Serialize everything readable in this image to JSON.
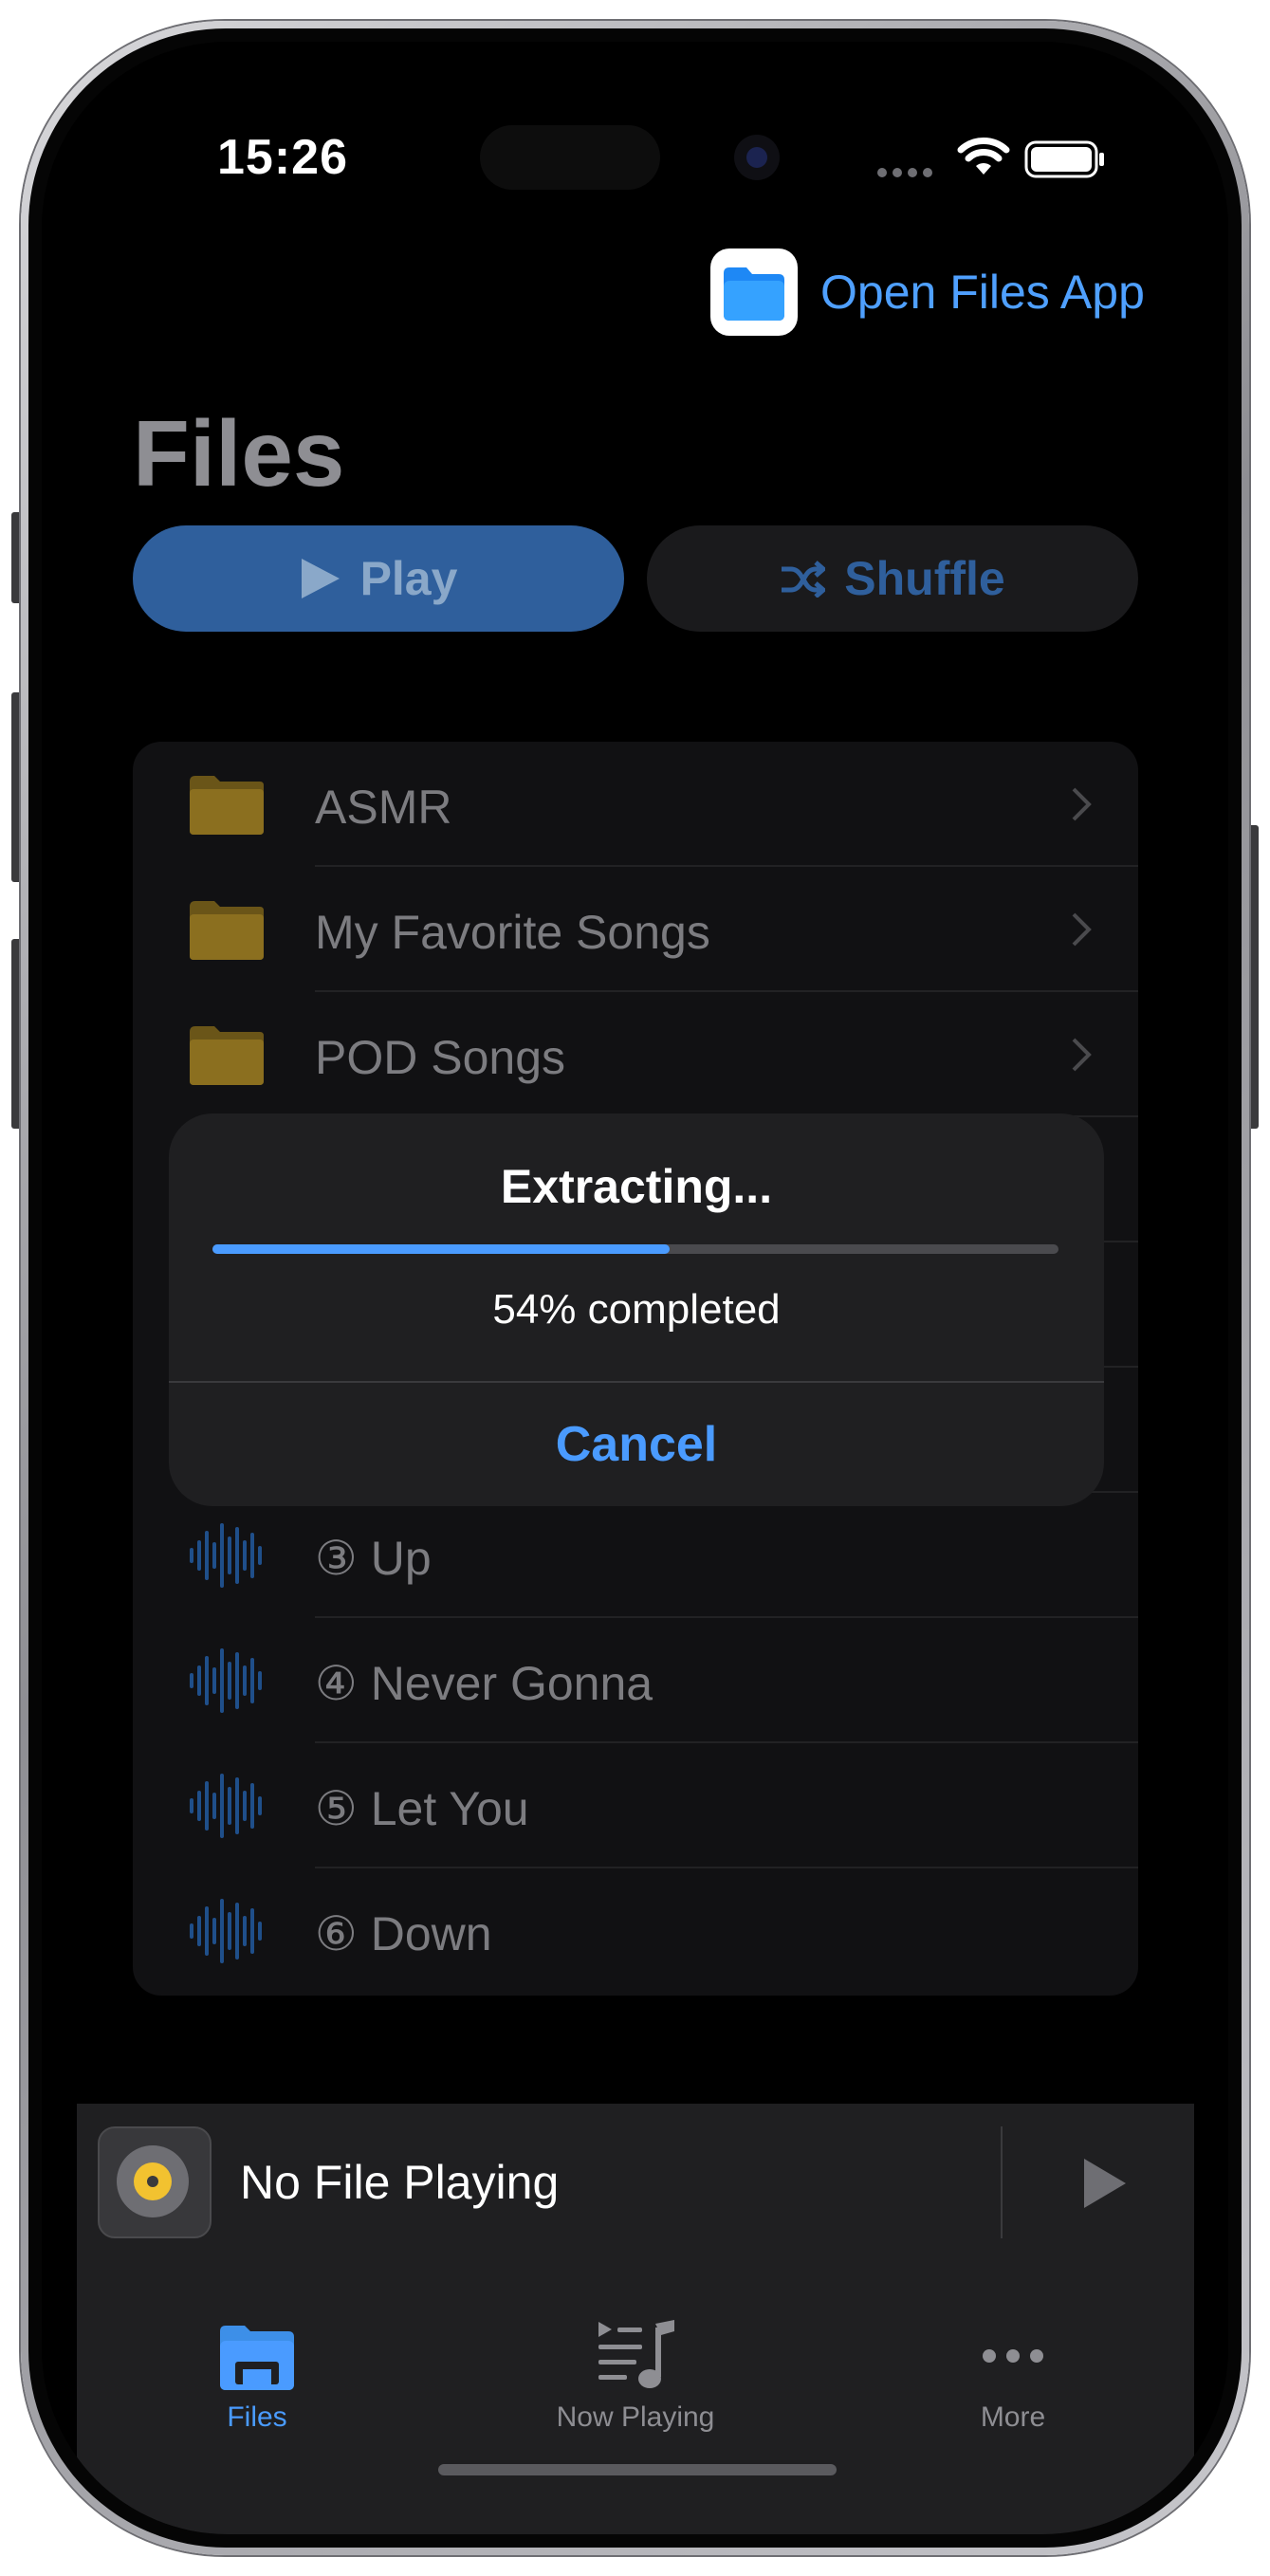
{
  "status_bar": {
    "time": "15:26"
  },
  "header": {
    "open_files_label": "Open Files App",
    "title": "Files"
  },
  "actions": {
    "play_label": "Play",
    "shuffle_label": "Shuffle"
  },
  "folders": [
    {
      "name": "ASMR",
      "icon": "folder-icon"
    },
    {
      "name": "My Favorite Songs",
      "icon": "folder-icon"
    },
    {
      "name": "POD Songs",
      "icon": "folder-icon"
    }
  ],
  "tracks": [
    {
      "name": "③ Up",
      "icon": "audio-waveform-icon"
    },
    {
      "name": "④ Never Gonna",
      "icon": "audio-waveform-icon"
    },
    {
      "name": "⑤ Let You",
      "icon": "audio-waveform-icon"
    },
    {
      "name": "⑥ Down",
      "icon": "audio-waveform-icon"
    }
  ],
  "dialog": {
    "title": "Extracting...",
    "progress_percent": 54,
    "status": "54% completed",
    "cancel_label": "Cancel"
  },
  "mini_player": {
    "title": "No File Playing"
  },
  "tabs": [
    {
      "label": "Files",
      "icon": "folder-icon",
      "active": true
    },
    {
      "label": "Now Playing",
      "icon": "music-list-icon",
      "active": false
    },
    {
      "label": "More",
      "icon": "ellipsis-icon",
      "active": false
    }
  ],
  "colors": {
    "accent": "#4a9bff",
    "play_button": "#2f5f9c",
    "folder": "#8b6f1f"
  }
}
